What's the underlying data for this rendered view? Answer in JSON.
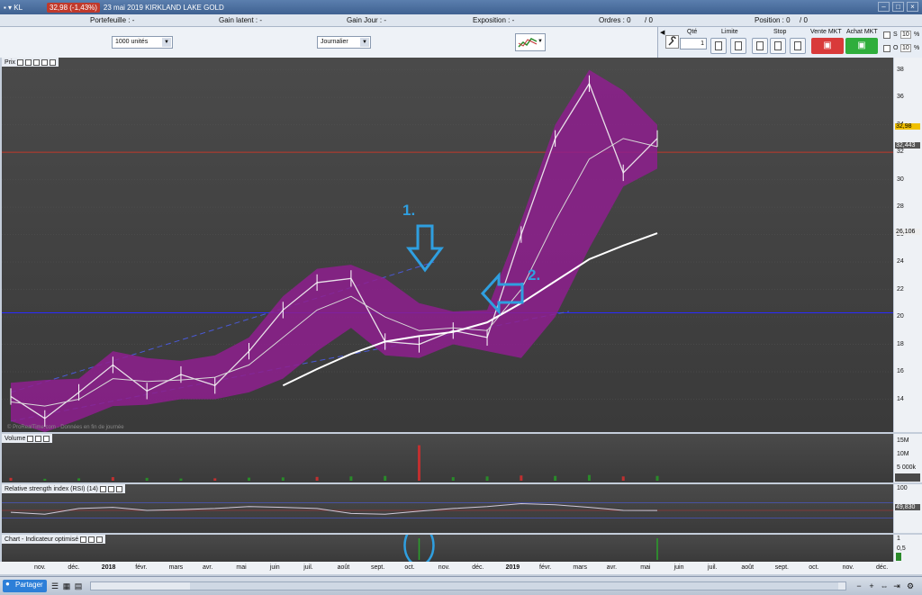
{
  "title": {
    "ticker": "KL",
    "price_change": "32,98 (-1,43%)",
    "text": "23 mai 2019  KIRKLAND LAKE GOLD"
  },
  "summary": {
    "portefeuille": "Portefeuille : -",
    "gain_latent": "Gain latent : -",
    "gain_jour": "Gain Jour : -",
    "exposition": "Exposition : -",
    "ordres": "Ordres : 0",
    "ordres_sep": "/ 0",
    "position": "Position : 0",
    "position_sep": "/ 0"
  },
  "controls": {
    "quantity_select": "1000 unités",
    "period_select": "Journalier"
  },
  "order_panel": {
    "qty_label": "Qté",
    "qty_value": "1",
    "limit_label": "Limite",
    "stop_label": "Stop",
    "sell_label": "Vente MKT",
    "buy_label": "Achat MKT",
    "s_label": "S",
    "o_label": "O",
    "s_value": "10",
    "o_value": "10",
    "pct": "%"
  },
  "panels": {
    "price": "Prix",
    "volume": "Volume",
    "rsi": "Relative strength index (RSI) (14)",
    "indicator": "Chart - Indicateur optimisé"
  },
  "price_axis": [
    "38",
    "36",
    "34",
    "32",
    "30",
    "28",
    "26",
    "24",
    "22",
    "20",
    "18",
    "16",
    "14"
  ],
  "price_tags": {
    "last": "32,98",
    "ma": "32,443",
    "ma200": "26,106",
    "hline": "20"
  },
  "volume_axis": [
    "15M",
    "10M",
    "5 000k"
  ],
  "rsi_axis": [
    "100"
  ],
  "rsi_value": "49,830",
  "indicator_axis": [
    "1",
    "0,5"
  ],
  "x_axis": [
    "nov.",
    "déc.",
    "2018",
    "févr.",
    "mars",
    "avr.",
    "mai",
    "juin",
    "juil.",
    "août",
    "sept.",
    "oct.",
    "nov.",
    "déc.",
    "2019",
    "févr.",
    "mars",
    "avr.",
    "mai",
    "juin",
    "juil.",
    "août",
    "sept.",
    "oct.",
    "nov.",
    "déc."
  ],
  "annotations": {
    "one": "1.",
    "two": "2."
  },
  "watermark": "© ProRealTime.com - Données en fin de journée",
  "statusbar": {
    "share": "Partager"
  },
  "colors": {
    "band": "#8e1f8e",
    "annotation": "#2f9fe0",
    "hline": "#2a2aff",
    "redline": "#c0392b"
  },
  "chart_data": {
    "type": "line",
    "title": "KIRKLAND LAKE GOLD",
    "xlabel": "",
    "ylabel": "",
    "ylim": [
      12,
      38.5
    ],
    "x": [
      "2017-10",
      "2017-11",
      "2017-12",
      "2018-01",
      "2018-02",
      "2018-03",
      "2018-04",
      "2018-05",
      "2018-06",
      "2018-07",
      "2018-08",
      "2018-09",
      "2018-10",
      "2018-11",
      "2018-12",
      "2019-01",
      "2019-02",
      "2019-03",
      "2019-04",
      "2019-05"
    ],
    "series": [
      {
        "values": [
          14.2,
          12.6,
          14.5,
          16.5,
          14.6,
          15.8,
          15.0,
          17.5,
          20.5,
          22.5,
          22.8,
          18.2,
          18.0,
          19.0,
          18.5,
          26.0,
          33.0,
          37.0,
          30.5,
          33.0
        ]
      },
      {
        "values": [
          13.8,
          13.5,
          14.0,
          15.5,
          15.3,
          15.4,
          15.6,
          16.5,
          18.5,
          20.5,
          21.5,
          20.0,
          19.0,
          19.2,
          19.0,
          22.0,
          27.0,
          31.5,
          33.0,
          32.4
        ]
      },
      {
        "values": [
          null,
          null,
          null,
          null,
          null,
          null,
          null,
          null,
          15.0,
          16.2,
          17.3,
          18.2,
          18.6,
          18.9,
          19.6,
          21.0,
          22.6,
          24.2,
          25.2,
          26.1
        ]
      }
    ],
    "hlines": [
      20.3,
      32.0
    ],
    "volume": [
      1.2,
      0.8,
      1.0,
      1.5,
      1.2,
      0.9,
      1.0,
      1.3,
      1.4,
      1.6,
      1.8,
      2.0,
      15.0,
      1.5,
      1.8,
      2.2,
      2.0,
      2.4,
      1.8,
      2.0
    ],
    "rsi": [
      45,
      40,
      55,
      58,
      50,
      52,
      55,
      60,
      58,
      55,
      42,
      40,
      48,
      55,
      60,
      68,
      65,
      58,
      50,
      49.8
    ],
    "indicator_spikes": [
      {
        "x": "2018-10",
        "value": 1
      },
      {
        "x": "2019-05",
        "value": 1
      }
    ]
  }
}
